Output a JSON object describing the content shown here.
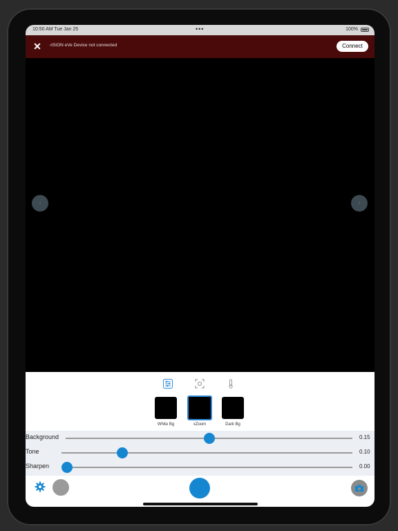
{
  "status_bar": {
    "time_date": "10:50 AM   Tue Jan 25",
    "dots": "•••",
    "battery": "100%"
  },
  "banner": {
    "close_icon": "close-icon",
    "message": "‹ISION eVe Device not connected",
    "connect_label": "Connect"
  },
  "nav": {
    "left_icon": "chevron-left-icon",
    "right_icon": "chevron-right-icon"
  },
  "modes": [
    {
      "icon": "sliders-icon"
    },
    {
      "icon": "focus-icon"
    },
    {
      "icon": "thermometer-icon"
    }
  ],
  "presets": [
    {
      "label": "White Bg",
      "selected": false
    },
    {
      "label": "xZoom",
      "selected": true
    },
    {
      "label": "Dark Bg",
      "selected": false
    }
  ],
  "sliders": [
    {
      "label": "Background",
      "value": "0.15",
      "level": 0.5
    },
    {
      "label": "Tone",
      "value": "0.10",
      "level": 0.21
    },
    {
      "label": "Sharpen",
      "value": "0.00",
      "level": 0.0
    }
  ],
  "bottom_bar": {
    "settings_icon": "gear-icon",
    "camera_icon": "camera-icon"
  },
  "colors": {
    "accent": "#1587d0",
    "banner": "#4a0a0a"
  }
}
